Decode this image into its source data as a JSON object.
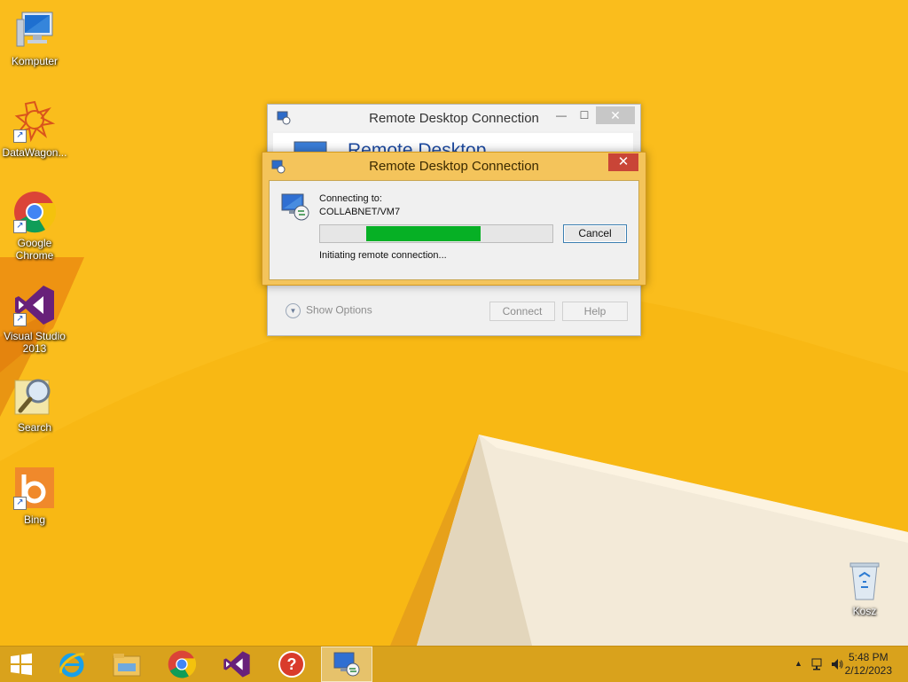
{
  "desktop": {
    "icons": [
      {
        "label": "Komputer"
      },
      {
        "label": "DataWagon..."
      },
      {
        "label": "Google Chrome"
      },
      {
        "label": "Visual Studio 2013"
      },
      {
        "label": "Search"
      },
      {
        "label": "Bing"
      },
      {
        "label": "Kosz"
      }
    ]
  },
  "back_window": {
    "title": "Remote Desktop Connection",
    "banner": "Remote Desktop",
    "show_options": "Show Options",
    "connect_label": "Connect",
    "help_label": "Help"
  },
  "front_window": {
    "title": "Remote Desktop Connection",
    "close_glyph": "✕",
    "connecting_to_label": "Connecting to:",
    "target": "COLLABNET/VM7",
    "progress_segment": {
      "start": 0.2,
      "end": 0.69
    },
    "cancel_label": "Cancel",
    "status_text": "Initiating remote connection..."
  },
  "taskbar": {
    "apps": [
      {
        "name": "Internet Explorer"
      },
      {
        "name": "File Explorer"
      },
      {
        "name": "Google Chrome"
      },
      {
        "name": "Visual Studio"
      },
      {
        "name": "Help"
      },
      {
        "name": "Remote Desktop Connection",
        "active": true
      }
    ],
    "tray_arrow": "▲",
    "clock_time": "5:48 PM",
    "clock_date": "2/12/2023"
  }
}
